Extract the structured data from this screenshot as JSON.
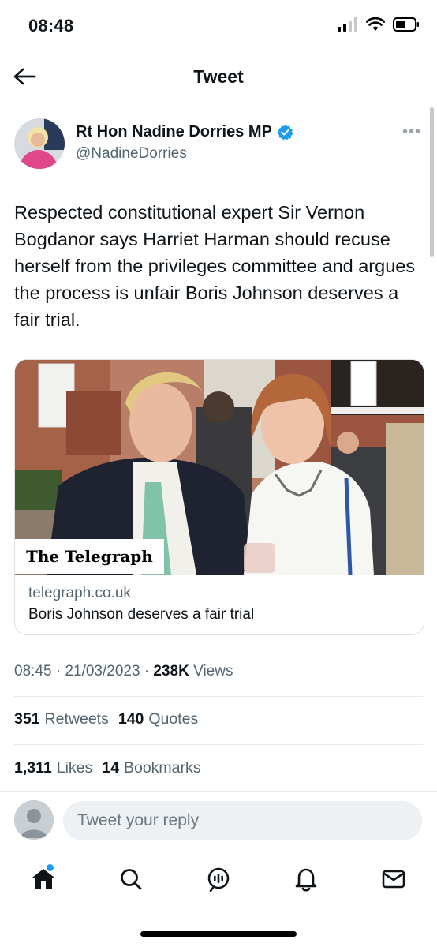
{
  "status_bar": {
    "time": "08:48"
  },
  "header": {
    "title": "Tweet"
  },
  "author": {
    "name": "Rt Hon Nadine Dorries MP",
    "handle": "@NadineDorries"
  },
  "tweet": {
    "text": "Respected constitutional expert Sir Vernon Bogdanor says Harriet Harman should recuse herself from the privileges committee and argues the process is unfair Boris Johnson deserves a fair trial."
  },
  "card": {
    "badge": "The Telegraph",
    "domain": "telegraph.co.uk",
    "title": "Boris Johnson deserves a fair trial"
  },
  "meta": {
    "time": "08:45",
    "date": "21/03/2023",
    "views_count": "238K",
    "views_label": "Views"
  },
  "stats": {
    "retweets_count": "351",
    "retweets_label": "Retweets",
    "quotes_count": "140",
    "quotes_label": "Quotes",
    "likes_count": "1,311",
    "likes_label": "Likes",
    "bookmarks_count": "14",
    "bookmarks_label": "Bookmarks"
  },
  "reply": {
    "placeholder": "Tweet your reply"
  },
  "colors": {
    "accent": "#1d9bf0",
    "text": "#0f1419",
    "secondary": "#536471"
  },
  "nav": {
    "items": [
      "home-icon",
      "search-icon",
      "spaces-icon",
      "notifications-icon",
      "messages-icon"
    ]
  }
}
